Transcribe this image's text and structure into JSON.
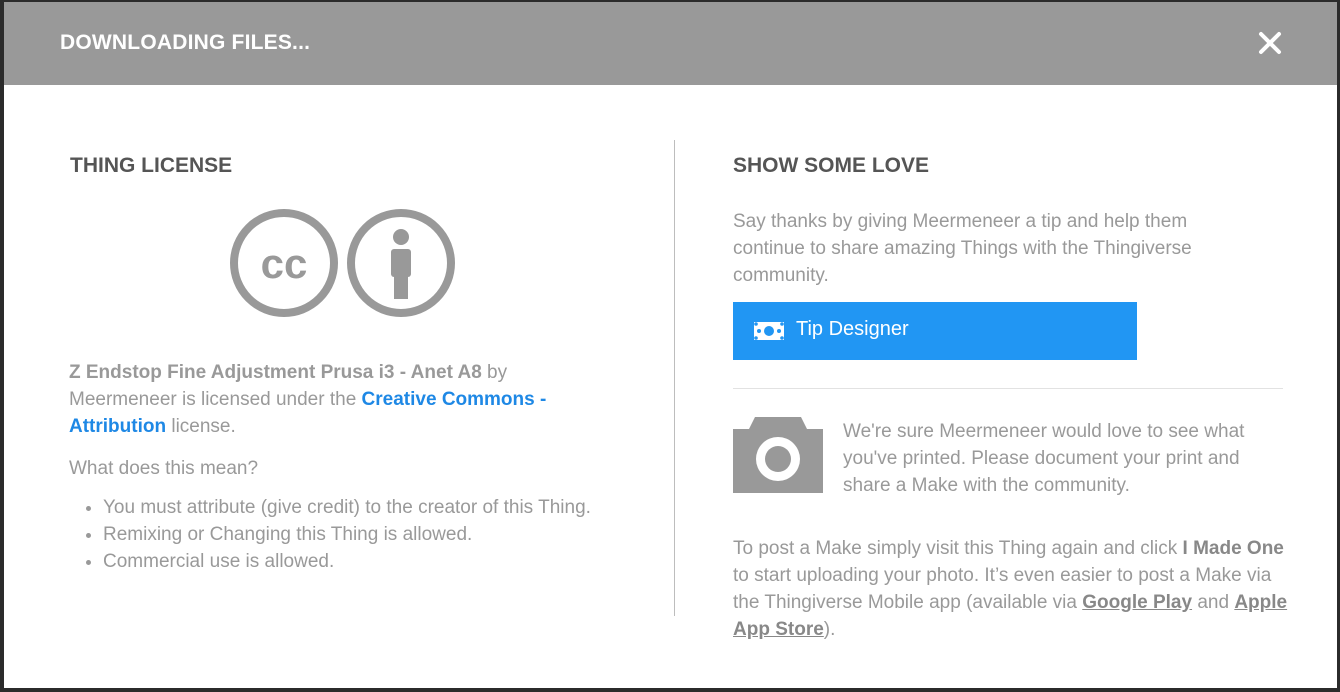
{
  "header": {
    "title": "DOWNLOADING FILES...",
    "close_icon": "close-icon"
  },
  "license": {
    "title": "THING LICENSE",
    "icons": [
      "creative-commons-icon",
      "attribution-person-icon"
    ],
    "thing_name": "Z Endstop Fine Adjustment Prusa i3 - Anet A8",
    "by": " by",
    "author_text": "Meermeneer is licensed under the ",
    "license_link": "Creative Commons - Attribution",
    "license_suffix": " license.",
    "question": "What does this mean?",
    "bullets": [
      "You must attribute (give credit) to the creator of this Thing.",
      "Remixing or Changing this Thing is allowed.",
      "Commercial use is allowed."
    ]
  },
  "love": {
    "title": "SHOW SOME LOVE",
    "description": "Say thanks by giving Meermeneer a tip and help them continue to share amazing Things with the Thingiverse community.",
    "tip_button": "Tip Designer",
    "tip_icon": "money-icon",
    "camera_icon": "camera-icon",
    "make_text": "We're sure Meermeneer would love to see what you've printed. Please document your print and share a Make with the community.",
    "post_intro": "To post a Make simply visit this Thing again and click ",
    "i_made_one": "I Made One",
    "post_middle": " to start uploading your photo. It’s even easier to post a Make via the Thingiverse Mobile app (available via ",
    "google_play": "Google Play",
    "and": " and ",
    "apple_store": "Apple App Store",
    "post_end": ")."
  },
  "colors": {
    "header_bg": "#999999",
    "accent_blue": "#2196f3",
    "link_blue": "#1e88e5",
    "text_gray": "#999999",
    "title_gray": "#555555"
  }
}
